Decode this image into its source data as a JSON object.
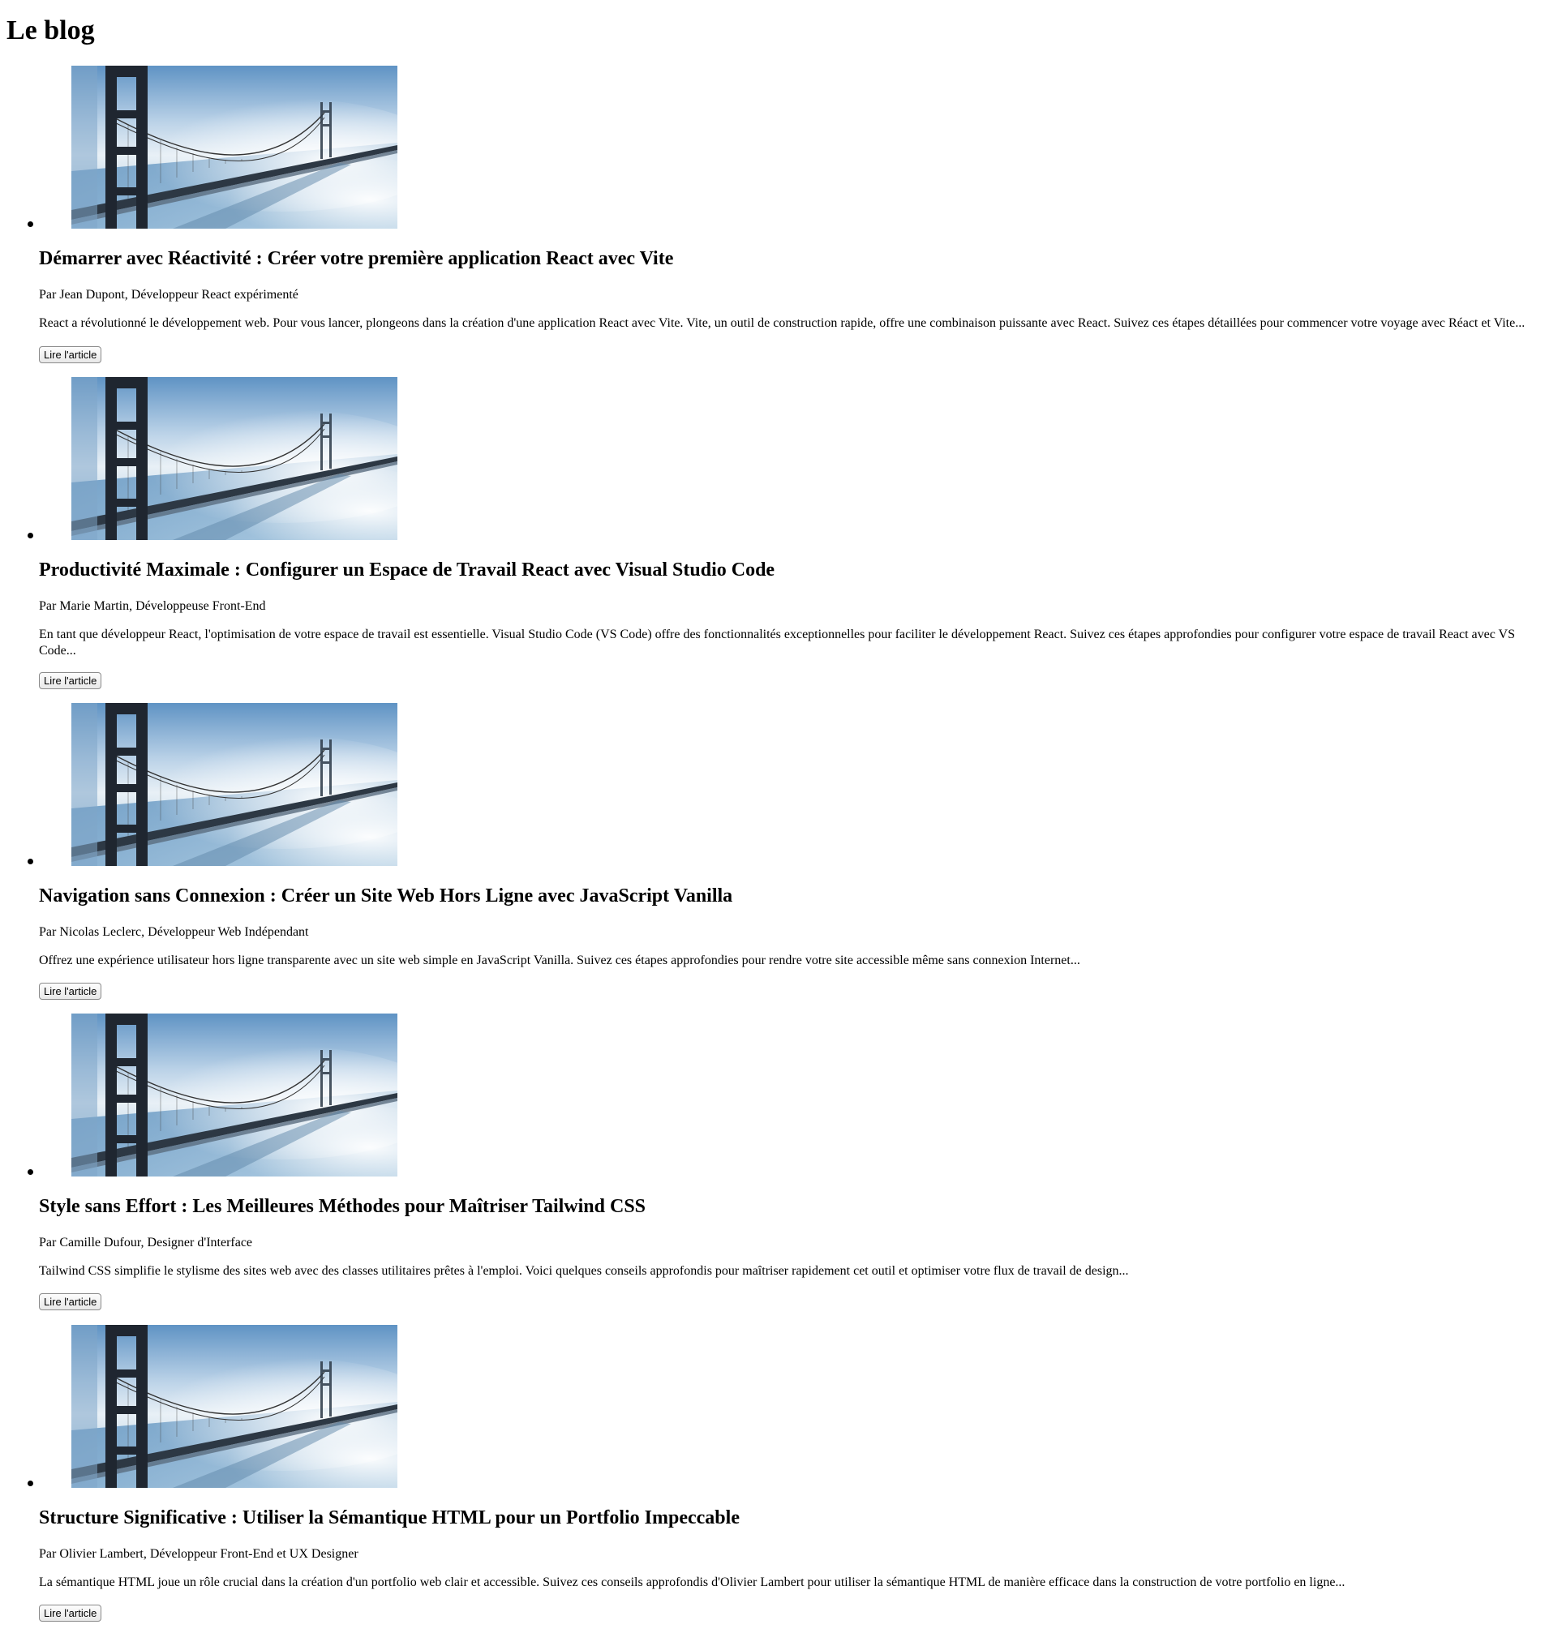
{
  "page": {
    "title": "Le blog"
  },
  "articles": [
    {
      "image": "golden-gate-bridge-fog",
      "title": "Démarrer avec Réactivité : Créer votre première application React avec Vite",
      "author": "Par Jean Dupont, Développeur React expérimenté",
      "excerpt": "React a révolutionné le développement web. Pour vous lancer, plongeons dans la création d'une application React avec Vite. Vite, un outil de construction rapide, offre une combinaison puissante avec React. Suivez ces étapes détaillées pour commencer votre voyage avec Réact et Vite...",
      "button_label": "Lire l'article"
    },
    {
      "image": "golden-gate-bridge-fog",
      "title": "Productivité Maximale : Configurer un Espace de Travail React avec Visual Studio Code",
      "author": "Par Marie Martin, Développeuse Front-End",
      "excerpt": "En tant que développeur React, l'optimisation de votre espace de travail est essentielle. Visual Studio Code (VS Code) offre des fonctionnalités exceptionnelles pour faciliter le développement React. Suivez ces étapes approfondies pour configurer votre espace de travail React avec VS Code...",
      "button_label": "Lire l'article"
    },
    {
      "image": "golden-gate-bridge-fog",
      "title": "Navigation sans Connexion : Créer un Site Web Hors Ligne avec JavaScript Vanilla",
      "author": "Par Nicolas Leclerc, Développeur Web Indépendant",
      "excerpt": "Offrez une expérience utilisateur hors ligne transparente avec un site web simple en JavaScript Vanilla. Suivez ces étapes approfondies pour rendre votre site accessible même sans connexion Internet...",
      "button_label": "Lire l'article"
    },
    {
      "image": "golden-gate-bridge-fog",
      "title": "Style sans Effort : Les Meilleures Méthodes pour Maîtriser Tailwind CSS",
      "author": "Par Camille Dufour, Designer d'Interface",
      "excerpt": "Tailwind CSS simplifie le stylisme des sites web avec des classes utilitaires prêtes à l'emploi. Voici quelques conseils approfondis pour maîtriser rapidement cet outil et optimiser votre flux de travail de design...",
      "button_label": "Lire l'article"
    },
    {
      "image": "golden-gate-bridge-fog",
      "title": "Structure Significative : Utiliser la Sémantique HTML pour un Portfolio Impeccable",
      "author": "Par Olivier Lambert, Développeur Front-End et UX Designer",
      "excerpt": "La sémantique HTML joue un rôle crucial dans la création d'un portfolio web clair et accessible. Suivez ces conseils approfondis d'Olivier Lambert pour utiliser la sémantique HTML de manière efficace dans la construction de votre portfolio en ligne...",
      "button_label": "Lire l'article"
    }
  ]
}
